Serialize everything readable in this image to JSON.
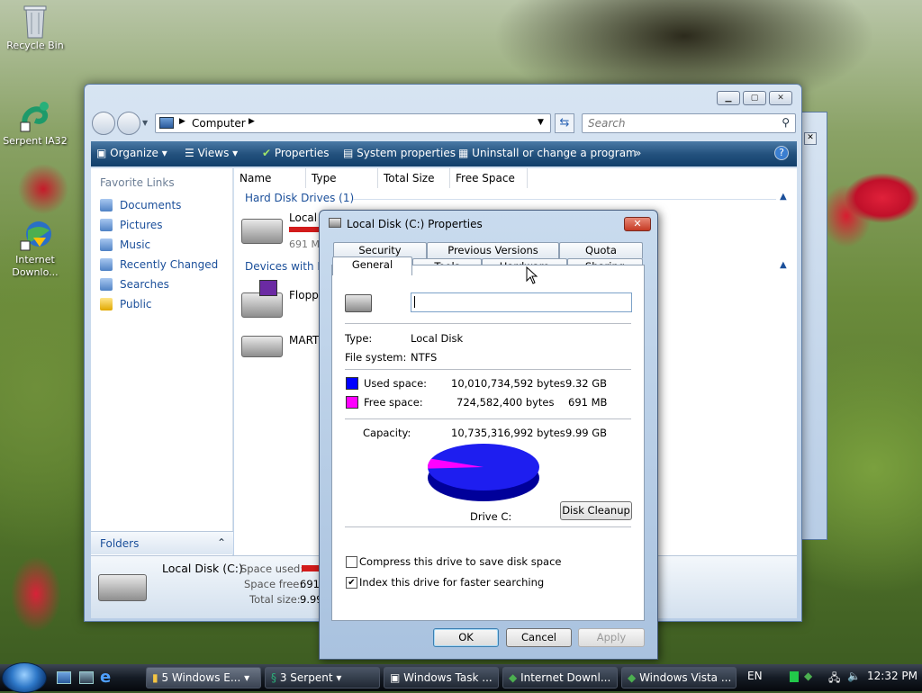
{
  "desktop": {
    "icons": [
      {
        "label": "Recycle Bin",
        "icon": "recycle-bin-icon"
      },
      {
        "label": "Serpent IA32",
        "icon": "serpent-icon"
      },
      {
        "label": "Internet\nDownlo...",
        "icon": "internet-download-icon"
      }
    ]
  },
  "explorer": {
    "address": [
      "Computer"
    ],
    "search_placeholder": "Search",
    "toolbar": [
      "Organize",
      "Views",
      "Properties",
      "System properties",
      "Uninstall or change a program",
      "»"
    ],
    "favorite_links_header": "Favorite Links",
    "favorite_links": [
      "Documents",
      "Pictures",
      "Music",
      "Recently Changed",
      "Searches",
      "Public"
    ],
    "folders_label": "Folders",
    "columns": [
      "Name",
      "Type",
      "Total Size",
      "Free Space"
    ],
    "group_hdd": "Hard Disk Drives (1)",
    "hdd_name": "Local",
    "hdd_free": "691 M",
    "group_removable": "Devices with Re",
    "device1": "Floppy",
    "device2": "MART",
    "details": {
      "name": "Local Disk (C:)",
      "space_used_label": "Space used:",
      "space_free_label": "Space free:",
      "space_free_value": "691",
      "total_size_label": "Total size:",
      "total_size_value": "9.99"
    }
  },
  "dialog": {
    "title": "Local Disk (C:) Properties",
    "tabs_back": [
      "Security",
      "Previous Versions",
      "Quota"
    ],
    "tabs_front": [
      "General",
      "Tools",
      "Hardware",
      "Sharing"
    ],
    "active_tab": "General",
    "label_value": "",
    "type_label": "Type:",
    "type_value": "Local Disk",
    "fs_label": "File system:",
    "fs_value": "NTFS",
    "used_label": "Used space:",
    "used_bytes": "10,010,734,592 bytes",
    "used_size": "9.32 GB",
    "free_label": "Free space:",
    "free_bytes": "724,582,400 bytes",
    "free_size": "691 MB",
    "capacity_label": "Capacity:",
    "capacity_bytes": "10,735,316,992 bytes",
    "capacity_size": "9.99 GB",
    "drive_label": "Drive C:",
    "disk_cleanup": "Disk Cleanup",
    "compress_label": "Compress this drive to save disk space",
    "compress_checked": false,
    "index_label": "Index this drive for faster searching",
    "index_checked": true,
    "ok": "OK",
    "cancel": "Cancel",
    "apply": "Apply",
    "colors": {
      "used": "#0000ff",
      "free": "#ff00ff"
    },
    "free_fraction": 0.0675
  },
  "taskbar": {
    "tasks": [
      "5 Windows E...",
      "3 Serpent",
      "Windows Task ...",
      "Internet Downl...",
      "Windows Vista ..."
    ],
    "language": "EN",
    "clock": "12:32 PM"
  }
}
